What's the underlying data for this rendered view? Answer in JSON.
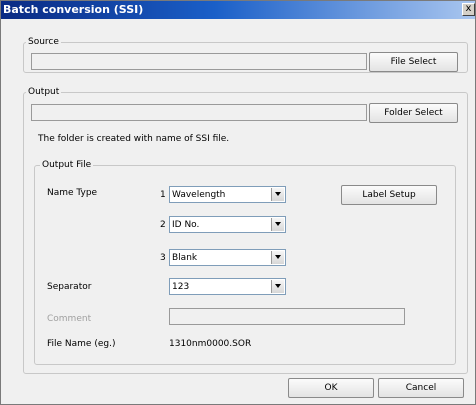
{
  "window": {
    "title": "Batch conversion (SSI)",
    "close_glyph": "x"
  },
  "source": {
    "legend": "Source",
    "path_value": "",
    "file_select_label": "File Select"
  },
  "output": {
    "legend": "Output",
    "path_value": "",
    "folder_select_label": "Folder Select",
    "note": "The folder is created with name of SSI file.",
    "output_file": {
      "legend": "Output File",
      "name_type_label": "Name Type",
      "selects": [
        {
          "index": "1",
          "value": "Wavelength"
        },
        {
          "index": "2",
          "value": "ID No."
        },
        {
          "index": "3",
          "value": "Blank"
        }
      ],
      "label_setup_label": "Label Setup",
      "separator_label": "Separator",
      "separator_value": "123",
      "comment_label": "Comment",
      "comment_value": "",
      "file_name_label": "File Name (eg.)",
      "file_name_value": "1310nm0000.SOR"
    }
  },
  "footer": {
    "ok_label": "OK",
    "cancel_label": "Cancel"
  }
}
